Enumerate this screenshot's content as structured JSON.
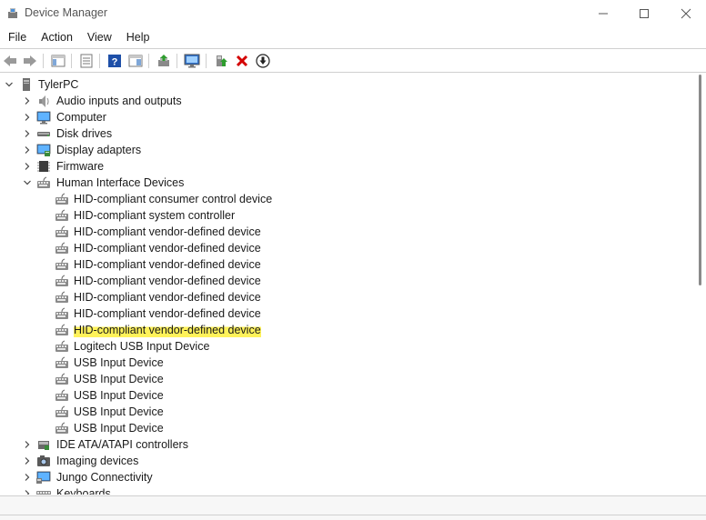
{
  "window": {
    "title": "Device Manager"
  },
  "menu": [
    "File",
    "Action",
    "View",
    "Help"
  ],
  "tree": {
    "root": "TylerPC",
    "categories": [
      "Audio inputs and outputs",
      "Computer",
      "Disk drives",
      "Display adapters",
      "Firmware",
      "Human Interface Devices"
    ],
    "hid_children": [
      "HID-compliant consumer control device",
      "HID-compliant system controller",
      "HID-compliant vendor-defined device",
      "HID-compliant vendor-defined device",
      "HID-compliant vendor-defined device",
      "HID-compliant vendor-defined device",
      "HID-compliant vendor-defined device",
      "HID-compliant vendor-defined device",
      "HID-compliant vendor-defined device",
      "Logitech USB Input Device",
      "USB Input Device",
      "USB Input Device",
      "USB Input Device",
      "USB Input Device",
      "USB Input Device"
    ],
    "after": [
      "IDE ATA/ATAPI controllers",
      "Imaging devices",
      "Jungo Connectivity",
      "Keyboards"
    ]
  },
  "colors": {
    "highlight": "#fff25a",
    "delete_red": "#d40000",
    "selected_icon_blue": "#1e63c6"
  }
}
